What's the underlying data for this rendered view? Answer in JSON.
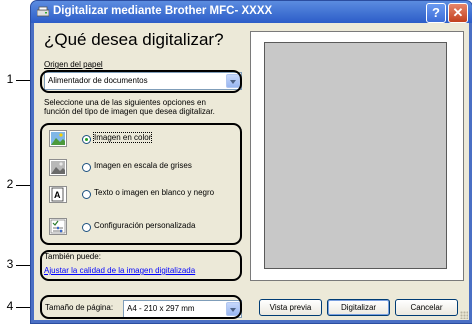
{
  "window": {
    "title": "Digitalizar mediante Brother MFC- XXXX",
    "help_label": "?",
    "close_label": "✕"
  },
  "heading": "¿Qué desea digitalizar?",
  "paper_source": {
    "label": "Origen del papel",
    "value": "Alimentador de documentos"
  },
  "instructions_line1": "Seleccione una de las siguientes opciones en",
  "instructions_line2": "función del tipo de imagen que desea digitalizar.",
  "options": [
    {
      "label": "Imagen en color",
      "selected": true,
      "icon": "color-image-icon"
    },
    {
      "label": "Imagen en escala de grises",
      "selected": false,
      "icon": "grayscale-image-icon"
    },
    {
      "label": "Texto o imagen en blanco y negro",
      "selected": false,
      "icon": "text-document-icon"
    },
    {
      "label": "Configuración personalizada",
      "selected": false,
      "icon": "custom-settings-icon"
    }
  ],
  "also": {
    "label": "También puede:",
    "link": "Ajustar la calidad de la imagen digitalizada"
  },
  "page_size": {
    "label": "Tamaño de página:",
    "value": "A4 - 210 x 297 mm"
  },
  "buttons": {
    "preview": "Vista previa",
    "scan": "Digitalizar",
    "cancel": "Cancelar"
  },
  "callouts": [
    "1",
    "2",
    "3",
    "4"
  ]
}
